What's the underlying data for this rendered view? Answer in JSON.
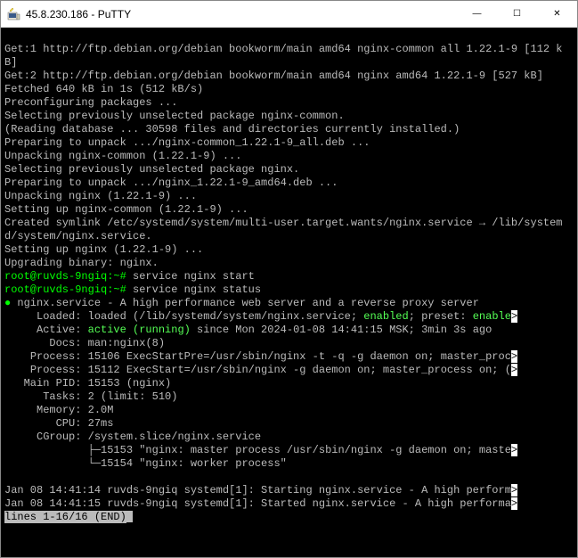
{
  "window": {
    "title": "45.8.230.186 - PuTTY",
    "buttons": {
      "min": "—",
      "max": "☐",
      "close": "✕"
    }
  },
  "term": {
    "l01": "Get:1 http://ftp.debian.org/debian bookworm/main amd64 nginx-common all 1.22.1-9 [112 kB]",
    "l02": "Get:2 http://ftp.debian.org/debian bookworm/main amd64 nginx amd64 1.22.1-9 [527 kB]",
    "l03": "Fetched 640 kB in 1s (512 kB/s)",
    "l04": "Preconfiguring packages ...",
    "l05": "Selecting previously unselected package nginx-common.",
    "l06": "(Reading database ... 30598 files and directories currently installed.)",
    "l07": "Preparing to unpack .../nginx-common_1.22.1-9_all.deb ...",
    "l08": "Unpacking nginx-common (1.22.1-9) ...",
    "l09": "Selecting previously unselected package nginx.",
    "l10": "Preparing to unpack .../nginx_1.22.1-9_amd64.deb ...",
    "l11": "Unpacking nginx (1.22.1-9) ...",
    "l12": "Setting up nginx-common (1.22.1-9) ...",
    "l13": "Created symlink /etc/systemd/system/multi-user.target.wants/nginx.service → /lib/systemd/system/nginx.service.",
    "l14": "Setting up nginx (1.22.1-9) ...",
    "l15": "Upgrading binary: nginx.",
    "prompt1": {
      "userhost": "root@ruvds-9ngiq:~#",
      "cmd": " service nginx start"
    },
    "prompt2": {
      "userhost": "root@ruvds-9ngiq:~#",
      "cmd": " service nginx status"
    },
    "status": {
      "dot": "●",
      "title": " nginx.service - A high performance web server and a reverse proxy server",
      "loaded_pre": "     Loaded: loaded (/lib/systemd/system/nginx.service; ",
      "enabled": "enabled",
      "loaded_mid": "; preset: ",
      "enabled2": "enable",
      "arrow": ">",
      "active_pre": "     Active: ",
      "active_val": "active (running)",
      "active_post": " since Mon 2024-01-08 14:41:15 MSK; 3min 3s ago",
      "docs": "       Docs: man:nginx(8)",
      "proc1": "    Process: 15106 ExecStartPre=/usr/sbin/nginx -t -q -g daemon on; master_proc",
      "proc2": "    Process: 15112 ExecStart=/usr/sbin/nginx -g daemon on; master_process on; (",
      "mainpid": "   Main PID: 15153 (nginx)",
      "tasks": "      Tasks: 2 (limit: 510)",
      "memory": "     Memory: 2.0M",
      "cpu": "        CPU: 27ms",
      "cgroup": "     CGroup: /system.slice/nginx.service",
      "tree1": "             ├─15153 \"nginx: master process /usr/sbin/nginx -g daemon on; maste",
      "tree2": "             └─15154 \"nginx: worker process\""
    },
    "log1": "Jan 08 14:41:14 ruvds-9ngiq systemd[1]: Starting nginx.service - A high perform",
    "log2": "Jan 08 14:41:15 ruvds-9ngiq systemd[1]: Started nginx.service - A high performa",
    "footer": "lines 1-16/16 (END)"
  }
}
